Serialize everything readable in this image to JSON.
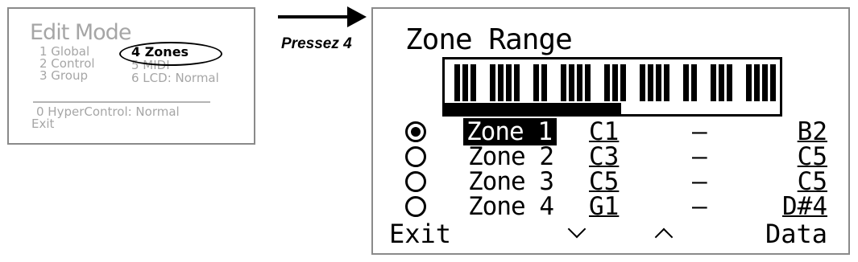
{
  "edit_mode": {
    "title": "Edit Mode",
    "items": [
      {
        "label": "1 Global"
      },
      {
        "label": "2 Control"
      },
      {
        "label": "3 Group"
      },
      {
        "label": "4 Zones"
      },
      {
        "label": "5 MIDI"
      },
      {
        "label": "6 LCD: Normal"
      }
    ],
    "hypercontrol": "0 HyperControl: Normal",
    "exit": "Exit"
  },
  "caption": "Pressez 4",
  "zone_range": {
    "title": "Zone Range",
    "zones": [
      {
        "name": "Zone 1",
        "start": "C1",
        "dash": "–",
        "end": "B2",
        "selected": true
      },
      {
        "name": "Zone 2",
        "start": "C3",
        "dash": "–",
        "end": "C5",
        "selected": false
      },
      {
        "name": "Zone 3",
        "start": "C5",
        "dash": "–",
        "end": "C5",
        "selected": false
      },
      {
        "name": "Zone 4",
        "start": "G1",
        "dash": "–",
        "end": "D#4",
        "selected": false
      }
    ],
    "softkeys": {
      "exit": "Exit",
      "down_icon": "chevron-down-icon",
      "up_icon": "chevron-up-icon",
      "data": "Data"
    }
  }
}
